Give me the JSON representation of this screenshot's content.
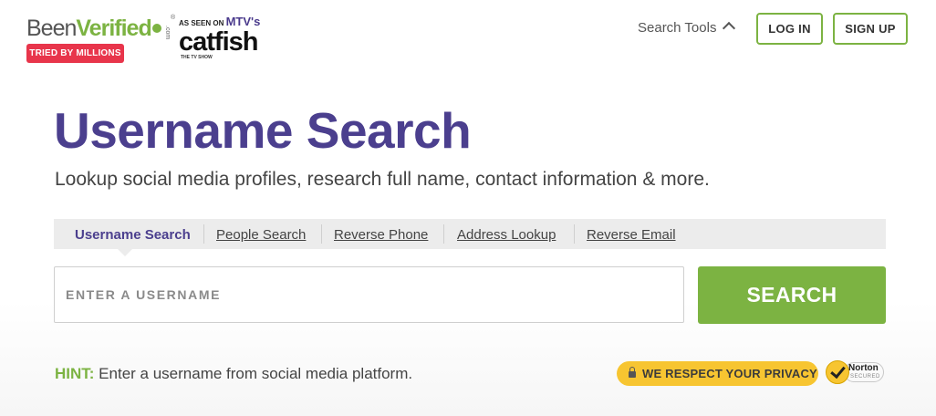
{
  "header": {
    "logo": {
      "been": "Been",
      "verified": "Verified",
      "com": ".com",
      "reg": "®"
    },
    "tagline_badge": "TRIED BY MILLIONS",
    "as_seen_on": "AS SEEN ON",
    "mtv": "MTV's",
    "catfish": "catfish",
    "tv_show": "THE TV SHOW",
    "search_tools_label": "Search Tools",
    "login_label": "LOG IN",
    "signup_label": "SIGN UP"
  },
  "hero": {
    "title": "Username Search",
    "subtitle": "Lookup social media profiles, research full name, contact information & more."
  },
  "tabs": [
    {
      "label": "Username Search",
      "active": true
    },
    {
      "label": "People Search",
      "active": false
    },
    {
      "label": "Reverse Phone",
      "active": false
    },
    {
      "label": "Address Lookup",
      "active": false
    },
    {
      "label": "Reverse Email",
      "active": false
    }
  ],
  "search": {
    "placeholder": "ENTER A USERNAME",
    "value": "",
    "button_label": "SEARCH"
  },
  "hint": {
    "label": "HINT:",
    "text": " Enter a username from social media platform."
  },
  "privacy": {
    "label": "WE RESPECT YOUR PRIVACY"
  },
  "norton": {
    "name": "Norton",
    "secured": "SECURED"
  },
  "colors": {
    "brand_purple": "#4b3f8e",
    "brand_green": "#7cb342",
    "badge_red": "#e8354b",
    "privacy_yellow": "#f7c531"
  },
  "icons": [
    "star-icon",
    "chevron-up-icon",
    "lock-icon",
    "norton-check-icon"
  ]
}
